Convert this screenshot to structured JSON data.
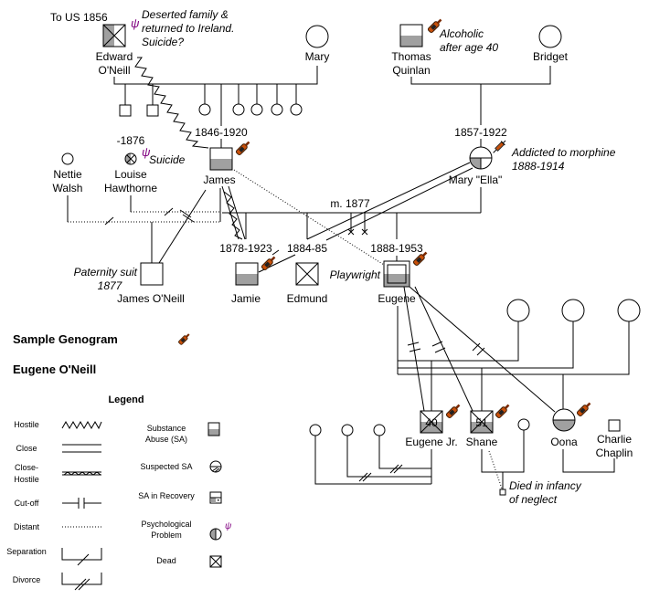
{
  "title": "Sample Genogram",
  "subtitle": "Eugene O'Neill",
  "colors": {
    "sa_fill": "#a0a0a0",
    "psych": "#800080",
    "bottle": "#c8500a"
  },
  "icons": {
    "psi": "ψ",
    "bottle": "bottle-icon",
    "syringe": "syringe-icon"
  },
  "people": {
    "edward": {
      "name1": "Edward",
      "name2": "O'Neill",
      "note": "To US 1856",
      "desc1": "Deserted family &",
      "desc2": "returned to Ireland.",
      "desc3": "Suicide?"
    },
    "mary": {
      "name": "Mary"
    },
    "thomas": {
      "name1": "Thomas",
      "name2": "Quinlan",
      "desc1": "Alcoholic",
      "desc2": "after age 40"
    },
    "bridget": {
      "name": "Bridget"
    },
    "james": {
      "name": "James",
      "dates": "1846-1920"
    },
    "ella": {
      "name": "Mary \"Ella\"",
      "dates": "1857-1922",
      "desc1": "Addicted to morphine",
      "desc2": "1888-1914"
    },
    "louise": {
      "name1": "Louise",
      "name2": "Hawthorne",
      "dates": "-1876",
      "desc": "Suicide"
    },
    "nettie": {
      "name1": "Nettie",
      "name2": "Walsh"
    },
    "jamesjr": {
      "name": "James O'Neill",
      "desc1": "Paternity suit",
      "desc2": "1877"
    },
    "marriage": "m. 1877",
    "jamie": {
      "name": "Jamie",
      "dates": "1878-1923"
    },
    "edmund": {
      "name": "Edmund",
      "dates": "1884-85"
    },
    "eugene": {
      "name": "Eugene",
      "dates": "1888-1953",
      "desc": "Playwright"
    },
    "eugenejr": {
      "name": "Eugene Jr.",
      "age": "40"
    },
    "shane": {
      "name": "Shane",
      "age": "51"
    },
    "oona": {
      "name": "Oona"
    },
    "charlie": {
      "name1": "Charlie",
      "name2": "Chaplin"
    },
    "infant": {
      "desc1": "Died in infancy",
      "desc2": "of neglect"
    }
  },
  "legend": {
    "title": "Legend",
    "relations": [
      "Hostile",
      "Close",
      "Close-",
      "Hostile",
      "Cut-off",
      "Distant",
      "Separation",
      "Divorce"
    ],
    "symbols": [
      "Substance",
      "Abuse (SA)",
      "Suspected SA",
      "SA in Recovery",
      "Psychological",
      "Problem",
      "Dead"
    ]
  }
}
